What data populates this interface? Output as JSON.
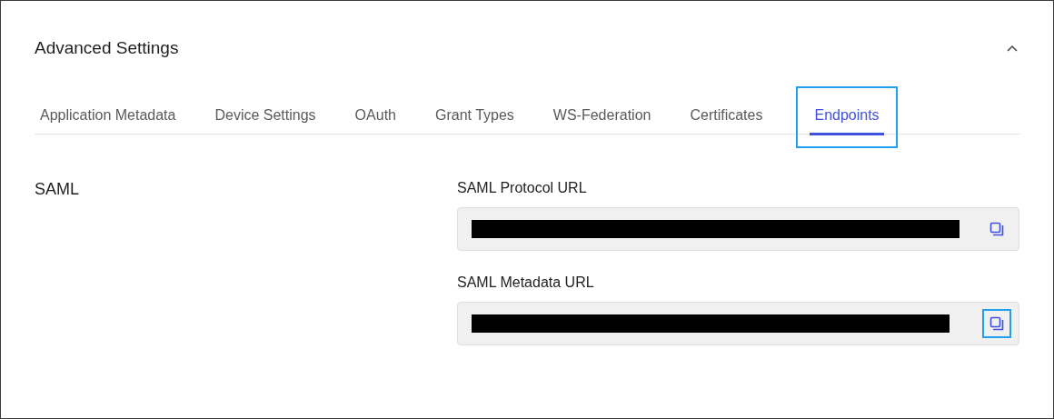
{
  "section": {
    "title": "Advanced Settings",
    "expanded": true
  },
  "tabs": [
    {
      "label": "Application Metadata",
      "selected": false,
      "highlighted": false
    },
    {
      "label": "Device Settings",
      "selected": false,
      "highlighted": false
    },
    {
      "label": "OAuth",
      "selected": false,
      "highlighted": false
    },
    {
      "label": "Grant Types",
      "selected": false,
      "highlighted": false
    },
    {
      "label": "WS-Federation",
      "selected": false,
      "highlighted": false
    },
    {
      "label": "Certificates",
      "selected": false,
      "highlighted": false
    },
    {
      "label": "Endpoints",
      "selected": true,
      "highlighted": true
    }
  ],
  "group": {
    "title": "SAML"
  },
  "fields": [
    {
      "label": "SAML Protocol URL",
      "redacted": true,
      "copy_highlighted": false
    },
    {
      "label": "SAML Metadata URL",
      "redacted": true,
      "copy_highlighted": true
    }
  ]
}
